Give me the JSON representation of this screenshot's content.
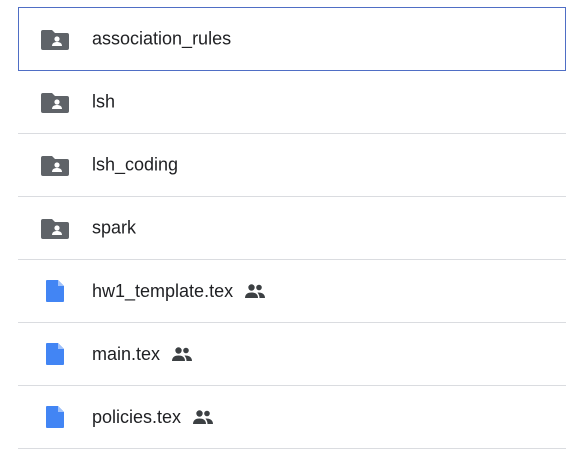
{
  "colors": {
    "folder_icon": "#5f6368",
    "doc_icon": "#4285f4",
    "shared_icon": "#3c4043",
    "selected_border": "#4f6ec5",
    "divider": "#dadce0",
    "text": "#202124"
  },
  "items": [
    {
      "name": "association_rules",
      "type": "shared-folder",
      "icon": "shared-folder-icon",
      "shared": false,
      "selected": true
    },
    {
      "name": "lsh",
      "type": "shared-folder",
      "icon": "shared-folder-icon",
      "shared": false,
      "selected": false
    },
    {
      "name": "lsh_coding",
      "type": "shared-folder",
      "icon": "shared-folder-icon",
      "shared": false,
      "selected": false
    },
    {
      "name": "spark",
      "type": "shared-folder",
      "icon": "shared-folder-icon",
      "shared": false,
      "selected": false
    },
    {
      "name": "hw1_template.tex",
      "type": "file",
      "icon": "document-icon",
      "shared": true,
      "selected": false
    },
    {
      "name": "main.tex",
      "type": "file",
      "icon": "document-icon",
      "shared": true,
      "selected": false
    },
    {
      "name": "policies.tex",
      "type": "file",
      "icon": "document-icon",
      "shared": true,
      "selected": false
    }
  ]
}
